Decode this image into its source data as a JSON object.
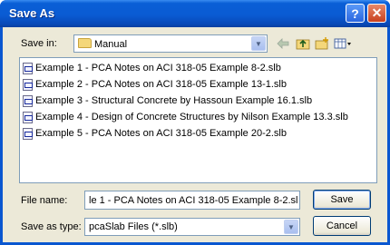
{
  "window": {
    "title": "Save As"
  },
  "titlebar": {
    "help_label": "?",
    "close_label": "✕"
  },
  "save_in": {
    "label": "Save in:",
    "value": "Manual"
  },
  "toolbar": {
    "icons": [
      "back-arrow-icon",
      "up-folder-icon",
      "new-folder-icon",
      "views-menu-icon"
    ]
  },
  "files": [
    "Example 1 - PCA Notes on ACI 318-05 Example 8-2.slb",
    "Example 2 - PCA Notes on ACI 318-05 Example 13-1.slb",
    "Example 3 - Structural Concrete by Hassoun Example 16.1.slb",
    "Example 4 - Design of Concrete Structures by Nilson Example 13.3.slb",
    "Example 5 - PCA Notes on ACI 318-05 Example 20-2.slb"
  ],
  "file_name": {
    "label": "File name:",
    "value": "le 1 - PCA Notes on ACI 318-05 Example 8-2.slb"
  },
  "save_type": {
    "label": "Save as type:",
    "value": "pcaSlab Files (*.slb)"
  },
  "buttons": {
    "save": "Save",
    "cancel": "Cancel"
  },
  "colors": {
    "title_bar": "#0a5bd3",
    "dialog_bg": "#ece9d8",
    "border_blue": "#7f9db9"
  }
}
